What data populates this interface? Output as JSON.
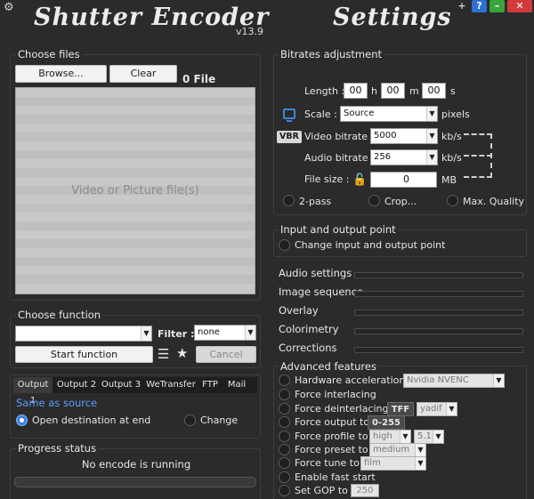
{
  "window": {
    "app_title": "Shutter Encoder",
    "version": "v13.9",
    "settings_title": "Settings",
    "buttons": [
      "+",
      "?",
      "–",
      "✕"
    ]
  },
  "files": {
    "title": "Choose files",
    "browse_label": "Browse...",
    "clear_label": "Clear",
    "count_label": "0 File",
    "dropzone_text": "Video or Picture file(s)"
  },
  "function": {
    "title": "Choose function",
    "selected": "",
    "filter_label": "Filter :",
    "filter_value": "none",
    "start_label": "Start function",
    "cancel_label": "Cancel"
  },
  "output": {
    "tabs": [
      "Output 1",
      "Output 2",
      "Output 3",
      "WeTransfer",
      "FTP",
      "Mail"
    ],
    "same_as_source": "Same as source",
    "open_destination": "Open destination at end",
    "change_label": "Change"
  },
  "progress": {
    "title": "Progress status",
    "status": "No encode is running"
  },
  "bitrates": {
    "title": "Bitrates adjustment",
    "length_label": "Length :",
    "length_h": "00",
    "length_m": "00",
    "length_s": "00",
    "unit_h": "h",
    "unit_m": "m",
    "unit_s": "s",
    "scale_label": "Scale :",
    "scale_value": "Source",
    "scale_unit": "pixels",
    "vbr_badge": "VBR",
    "video_label": "Video bitrate :",
    "video_value": "5000",
    "video_unit": "kb/s",
    "audio_label": "Audio bitrate :",
    "audio_value": "256",
    "audio_unit": "kb/s",
    "filesize_label": "File size :",
    "filesize_value": "0",
    "filesize_unit": "MB",
    "two_pass": "2-pass",
    "crop": "Crop...",
    "max_quality": "Max. Quality"
  },
  "inout": {
    "title": "Input and output point",
    "change_label": "Change input and output point"
  },
  "sections": [
    "Audio settings",
    "Image sequence",
    "Overlay",
    "Colorimetry",
    "Corrections"
  ],
  "advanced": {
    "title": "Advanced features",
    "hw_label": "Hardware acceleration :",
    "hw_value": "Nvidia NVENC",
    "force_interlacing": "Force interlacing",
    "force_deinterlacing": "Force deinterlacing :",
    "deint_tag": "TFF",
    "deint_value": "yadif",
    "force_output": "Force output to :",
    "output_tag": "0-255",
    "force_profile": "Force profile to :",
    "profile_value": "high",
    "level_value": "5.1",
    "force_preset": "Force preset to :",
    "preset_value": "medium",
    "force_tune": "Force tune to :",
    "tune_value": "film",
    "fast_start": "Enable fast start",
    "gop_label": "Set GOP to :",
    "gop_value": "250"
  }
}
